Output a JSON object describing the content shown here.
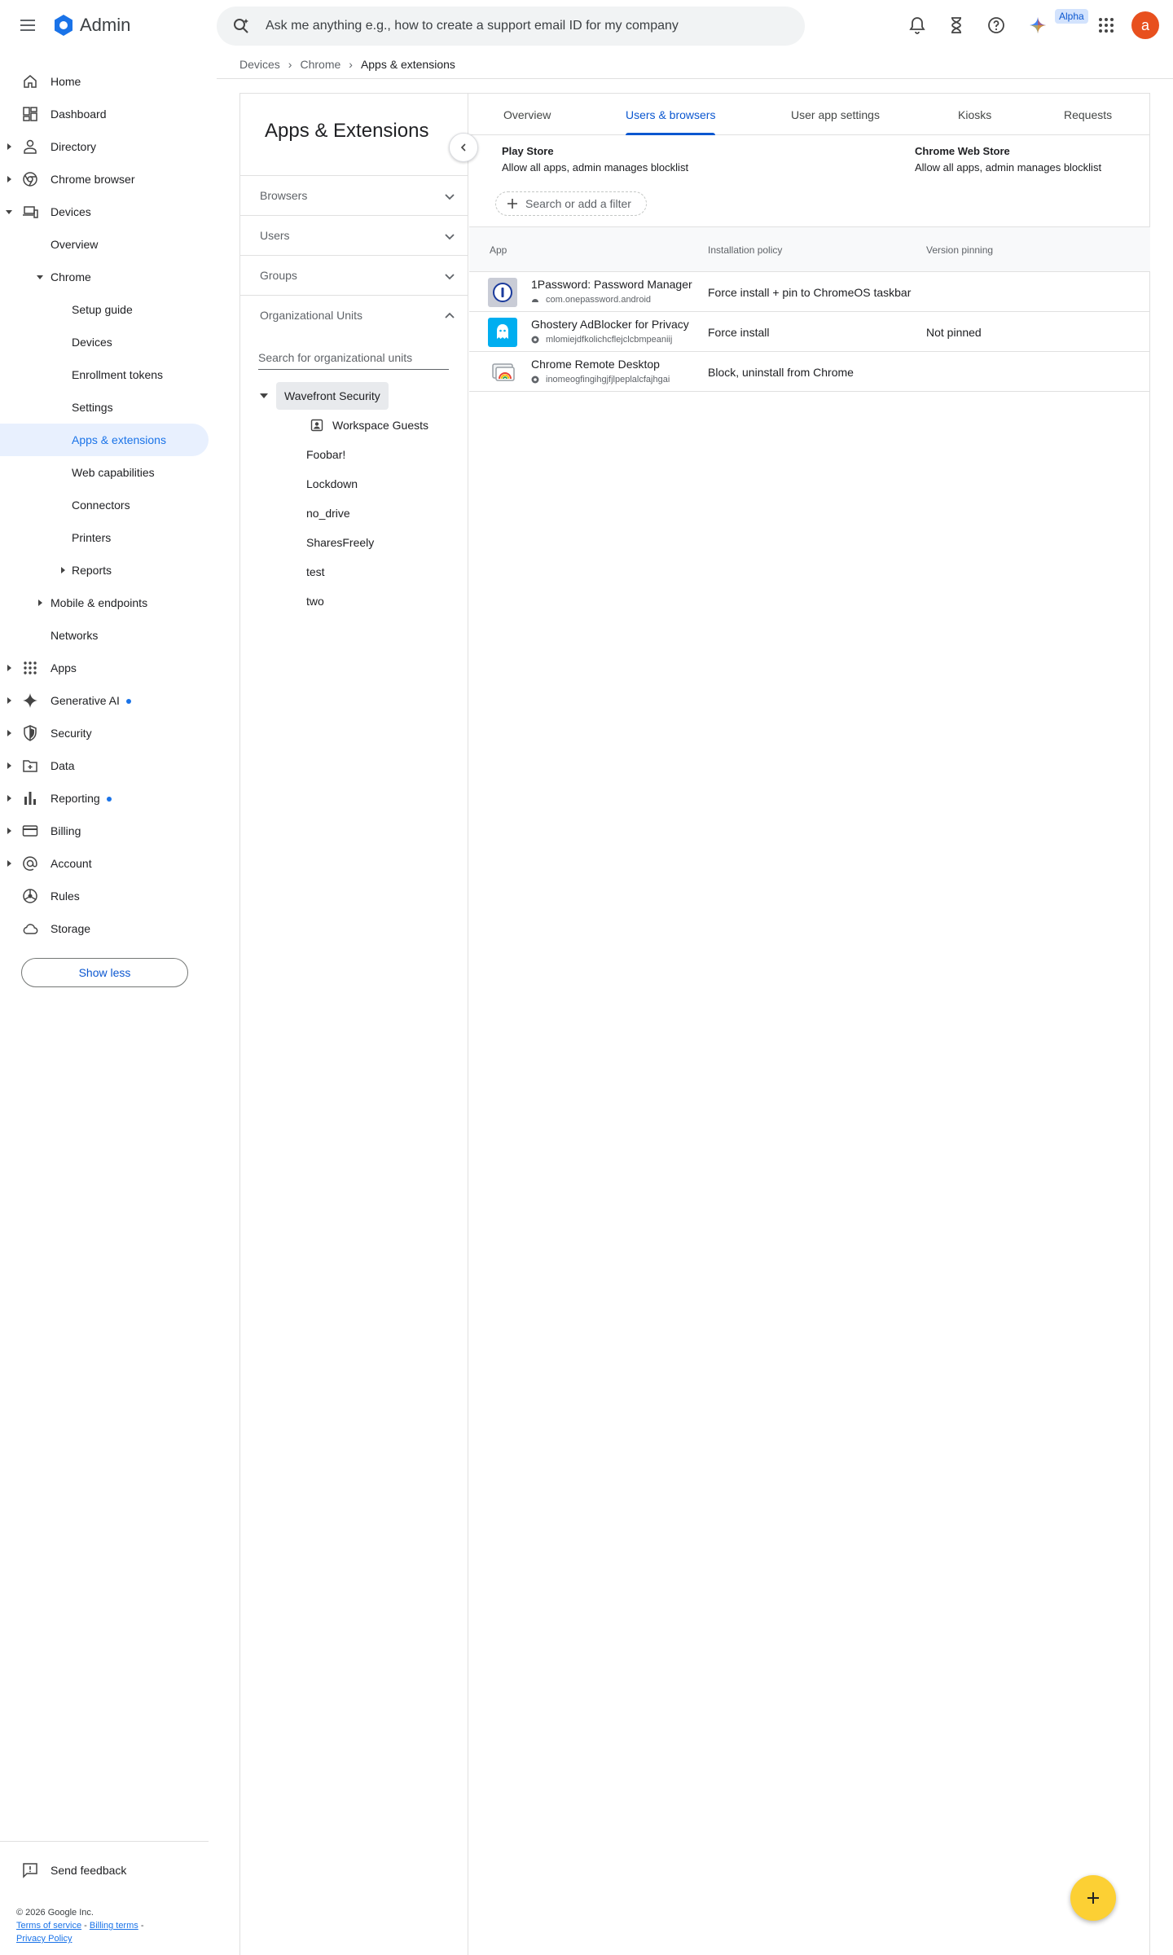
{
  "app": {
    "title": "Admin"
  },
  "search": {
    "placeholder": "Ask me anything e.g., how to create a support email ID for my company"
  },
  "header": {
    "alpha_badge": "Alpha",
    "avatar_letter": "a"
  },
  "breadcrumb": [
    "Devices",
    "Chrome",
    "Apps & extensions"
  ],
  "sidebar": {
    "items": [
      {
        "label": "Home",
        "icon": "home-icon"
      },
      {
        "label": "Dashboard",
        "icon": "dashboard-icon"
      },
      {
        "label": "Directory",
        "icon": "person-icon"
      },
      {
        "label": "Chrome browser",
        "icon": "chrome-icon"
      },
      {
        "label": "Devices",
        "icon": "devices-icon"
      },
      {
        "label": "Overview"
      },
      {
        "label": "Chrome"
      },
      {
        "label": "Setup guide"
      },
      {
        "label": "Devices"
      },
      {
        "label": "Enrollment tokens"
      },
      {
        "label": "Settings"
      },
      {
        "label": "Apps & extensions"
      },
      {
        "label": "Web capabilities"
      },
      {
        "label": "Connectors"
      },
      {
        "label": "Printers"
      },
      {
        "label": "Reports"
      },
      {
        "label": "Mobile & endpoints"
      },
      {
        "label": "Networks"
      },
      {
        "label": "Apps",
        "icon": "apps-grid-icon"
      },
      {
        "label": "Generative AI",
        "icon": "sparkle-icon"
      },
      {
        "label": "Security",
        "icon": "shield-icon"
      },
      {
        "label": "Data",
        "icon": "folder-icon"
      },
      {
        "label": "Reporting",
        "icon": "bar-chart-icon"
      },
      {
        "label": "Billing",
        "icon": "credit-card-icon"
      },
      {
        "label": "Account",
        "icon": "at-sign-icon"
      },
      {
        "label": "Rules",
        "icon": "rules-icon"
      },
      {
        "label": "Storage",
        "icon": "cloud-icon"
      }
    ],
    "show_less": "Show less",
    "send_feedback": "Send feedback"
  },
  "footer": {
    "copyright": "© 2026 Google Inc.",
    "terms": "Terms of service",
    "billing_terms": "Billing terms",
    "privacy": "Privacy Policy"
  },
  "left_pane": {
    "title": "Apps & Extensions",
    "filters": [
      "Browsers",
      "Users",
      "Groups",
      "Organizational Units"
    ],
    "ou_search_placeholder": "Search for organizational units",
    "ou_root": "Wavefront Security",
    "ou_children": [
      "Workspace Guests",
      "Foobar!",
      "Lockdown",
      "no_drive",
      "SharesFreely",
      "test",
      "two"
    ]
  },
  "tabs": [
    "Overview",
    "Users & browsers",
    "User app settings",
    "Kiosks",
    "Requests"
  ],
  "active_tab": "Users & browsers",
  "stores": {
    "play": {
      "name": "Play Store",
      "policy": "Allow all apps, admin manages blocklist"
    },
    "cws": {
      "name": "Chrome Web Store",
      "policy": "Allow all apps, admin manages blocklist"
    }
  },
  "filter_chip": "Search or add a filter",
  "table": {
    "headers": [
      "App",
      "Installation policy",
      "Version pinning"
    ],
    "rows": [
      {
        "name": "1Password: Password Manager",
        "id": "com.onepassword.android",
        "policy": "Force install + pin to ChromeOS taskbar",
        "pinning": ""
      },
      {
        "name": "Ghostery AdBlocker for Privacy",
        "id": "mlomiejdfkolichcflejclcbmpeaniij",
        "policy": "Force install",
        "pinning": "Not pinned"
      },
      {
        "name": "Chrome Remote Desktop",
        "id": "inomeogfingihgjfjlpeplalcfajhgai",
        "policy": "Block, uninstall from Chrome",
        "pinning": ""
      }
    ]
  },
  "colors": {
    "accent": "#0b57d0",
    "fab": "#fcd034",
    "avatar": "#e8501e"
  }
}
